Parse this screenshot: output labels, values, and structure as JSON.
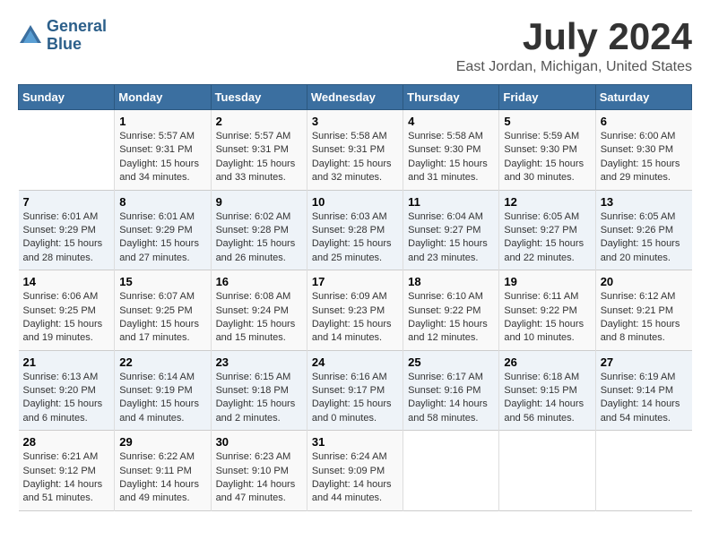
{
  "logo": {
    "line1": "General",
    "line2": "Blue"
  },
  "title": "July 2024",
  "location": "East Jordan, Michigan, United States",
  "weekdays": [
    "Sunday",
    "Monday",
    "Tuesday",
    "Wednesday",
    "Thursday",
    "Friday",
    "Saturday"
  ],
  "weeks": [
    [
      {
        "day": "",
        "content": ""
      },
      {
        "day": "1",
        "content": "Sunrise: 5:57 AM\nSunset: 9:31 PM\nDaylight: 15 hours\nand 34 minutes."
      },
      {
        "day": "2",
        "content": "Sunrise: 5:57 AM\nSunset: 9:31 PM\nDaylight: 15 hours\nand 33 minutes."
      },
      {
        "day": "3",
        "content": "Sunrise: 5:58 AM\nSunset: 9:31 PM\nDaylight: 15 hours\nand 32 minutes."
      },
      {
        "day": "4",
        "content": "Sunrise: 5:58 AM\nSunset: 9:30 PM\nDaylight: 15 hours\nand 31 minutes."
      },
      {
        "day": "5",
        "content": "Sunrise: 5:59 AM\nSunset: 9:30 PM\nDaylight: 15 hours\nand 30 minutes."
      },
      {
        "day": "6",
        "content": "Sunrise: 6:00 AM\nSunset: 9:30 PM\nDaylight: 15 hours\nand 29 minutes."
      }
    ],
    [
      {
        "day": "7",
        "content": "Sunrise: 6:01 AM\nSunset: 9:29 PM\nDaylight: 15 hours\nand 28 minutes."
      },
      {
        "day": "8",
        "content": "Sunrise: 6:01 AM\nSunset: 9:29 PM\nDaylight: 15 hours\nand 27 minutes."
      },
      {
        "day": "9",
        "content": "Sunrise: 6:02 AM\nSunset: 9:28 PM\nDaylight: 15 hours\nand 26 minutes."
      },
      {
        "day": "10",
        "content": "Sunrise: 6:03 AM\nSunset: 9:28 PM\nDaylight: 15 hours\nand 25 minutes."
      },
      {
        "day": "11",
        "content": "Sunrise: 6:04 AM\nSunset: 9:27 PM\nDaylight: 15 hours\nand 23 minutes."
      },
      {
        "day": "12",
        "content": "Sunrise: 6:05 AM\nSunset: 9:27 PM\nDaylight: 15 hours\nand 22 minutes."
      },
      {
        "day": "13",
        "content": "Sunrise: 6:05 AM\nSunset: 9:26 PM\nDaylight: 15 hours\nand 20 minutes."
      }
    ],
    [
      {
        "day": "14",
        "content": "Sunrise: 6:06 AM\nSunset: 9:25 PM\nDaylight: 15 hours\nand 19 minutes."
      },
      {
        "day": "15",
        "content": "Sunrise: 6:07 AM\nSunset: 9:25 PM\nDaylight: 15 hours\nand 17 minutes."
      },
      {
        "day": "16",
        "content": "Sunrise: 6:08 AM\nSunset: 9:24 PM\nDaylight: 15 hours\nand 15 minutes."
      },
      {
        "day": "17",
        "content": "Sunrise: 6:09 AM\nSunset: 9:23 PM\nDaylight: 15 hours\nand 14 minutes."
      },
      {
        "day": "18",
        "content": "Sunrise: 6:10 AM\nSunset: 9:22 PM\nDaylight: 15 hours\nand 12 minutes."
      },
      {
        "day": "19",
        "content": "Sunrise: 6:11 AM\nSunset: 9:22 PM\nDaylight: 15 hours\nand 10 minutes."
      },
      {
        "day": "20",
        "content": "Sunrise: 6:12 AM\nSunset: 9:21 PM\nDaylight: 15 hours\nand 8 minutes."
      }
    ],
    [
      {
        "day": "21",
        "content": "Sunrise: 6:13 AM\nSunset: 9:20 PM\nDaylight: 15 hours\nand 6 minutes."
      },
      {
        "day": "22",
        "content": "Sunrise: 6:14 AM\nSunset: 9:19 PM\nDaylight: 15 hours\nand 4 minutes."
      },
      {
        "day": "23",
        "content": "Sunrise: 6:15 AM\nSunset: 9:18 PM\nDaylight: 15 hours\nand 2 minutes."
      },
      {
        "day": "24",
        "content": "Sunrise: 6:16 AM\nSunset: 9:17 PM\nDaylight: 15 hours\nand 0 minutes."
      },
      {
        "day": "25",
        "content": "Sunrise: 6:17 AM\nSunset: 9:16 PM\nDaylight: 14 hours\nand 58 minutes."
      },
      {
        "day": "26",
        "content": "Sunrise: 6:18 AM\nSunset: 9:15 PM\nDaylight: 14 hours\nand 56 minutes."
      },
      {
        "day": "27",
        "content": "Sunrise: 6:19 AM\nSunset: 9:14 PM\nDaylight: 14 hours\nand 54 minutes."
      }
    ],
    [
      {
        "day": "28",
        "content": "Sunrise: 6:21 AM\nSunset: 9:12 PM\nDaylight: 14 hours\nand 51 minutes."
      },
      {
        "day": "29",
        "content": "Sunrise: 6:22 AM\nSunset: 9:11 PM\nDaylight: 14 hours\nand 49 minutes."
      },
      {
        "day": "30",
        "content": "Sunrise: 6:23 AM\nSunset: 9:10 PM\nDaylight: 14 hours\nand 47 minutes."
      },
      {
        "day": "31",
        "content": "Sunrise: 6:24 AM\nSunset: 9:09 PM\nDaylight: 14 hours\nand 44 minutes."
      },
      {
        "day": "",
        "content": ""
      },
      {
        "day": "",
        "content": ""
      },
      {
        "day": "",
        "content": ""
      }
    ]
  ]
}
